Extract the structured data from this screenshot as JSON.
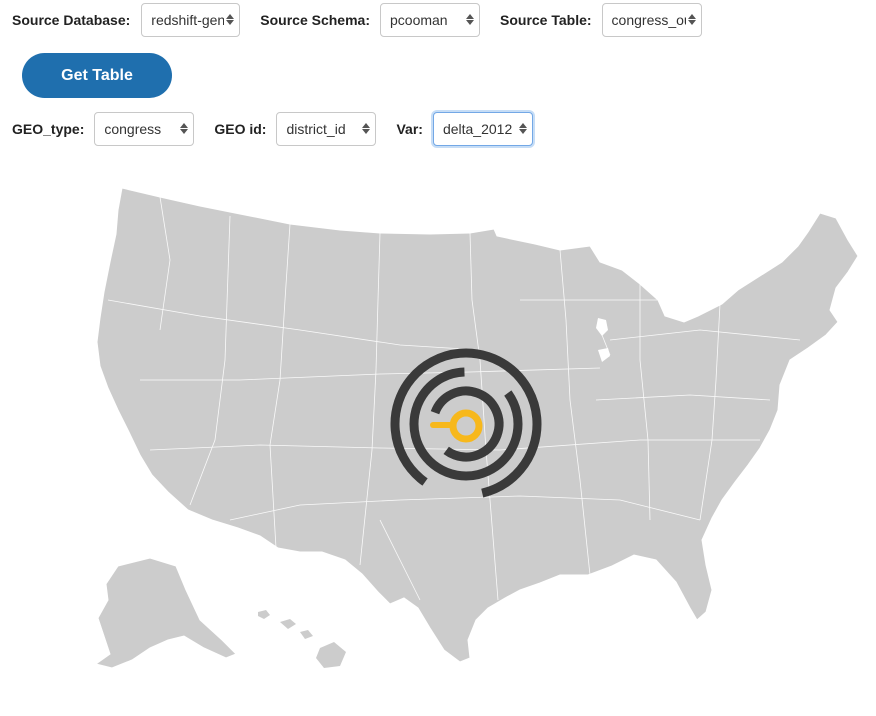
{
  "controls": {
    "source_database": {
      "label": "Source Database:",
      "value": "redshift-gen"
    },
    "source_schema": {
      "label": "Source Schema:",
      "value": "pcooman"
    },
    "source_table": {
      "label": "Source Table:",
      "value": "congress_ou"
    },
    "get_table_button": "Get Table",
    "geo_type": {
      "label": "GEO_type:",
      "value": "congress"
    },
    "geo_id": {
      "label": "GEO id:",
      "value": "district_id"
    },
    "var": {
      "label": "Var:",
      "value": "delta_2012"
    }
  },
  "colors": {
    "button": "#1f6fae",
    "map_fill": "#cccccc",
    "map_borders": "#ffffff",
    "spinner_dark": "#3a3a3a",
    "spinner_accent": "#f7b81c"
  },
  "icons": [
    "up-down-arrow-icon",
    "loading-spinner-icon"
  ],
  "map": {
    "name": "us-congressional-districts-map"
  }
}
